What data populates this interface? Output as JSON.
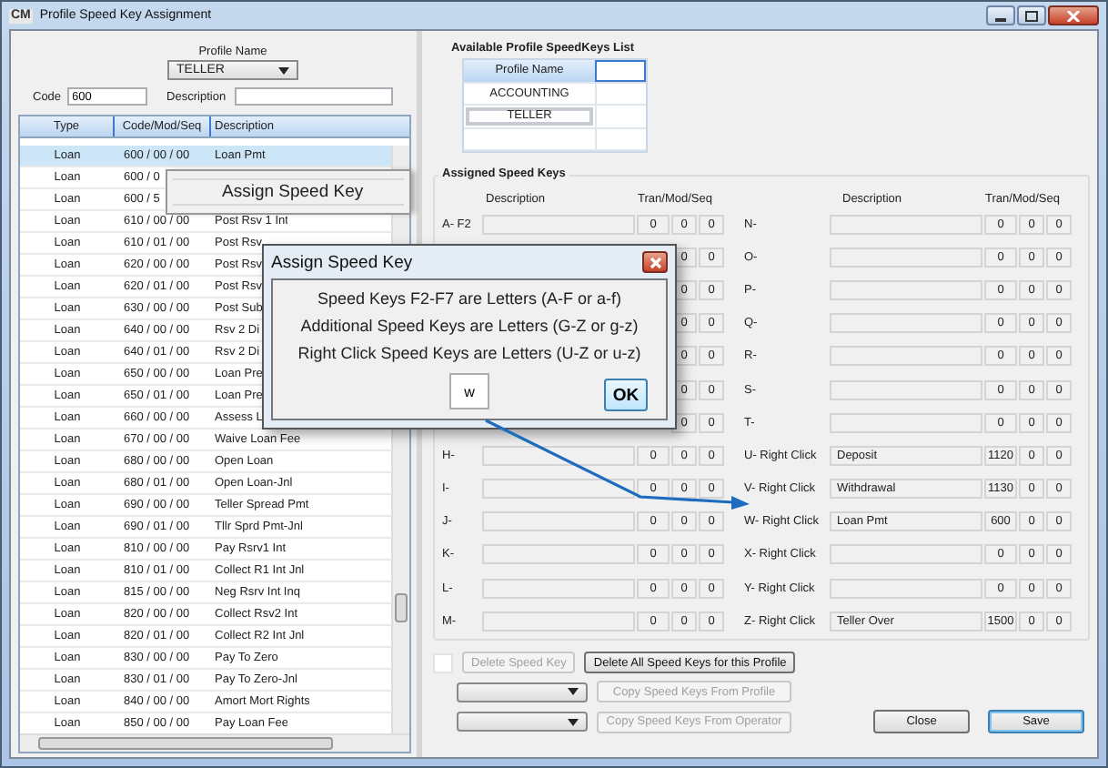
{
  "window": {
    "title": "Profile Speed Key Assignment",
    "logo": "CM"
  },
  "profile": {
    "label": "Profile Name",
    "value": "TELLER"
  },
  "filters": {
    "code_label": "Code",
    "code_value": "600",
    "description_label": "Description"
  },
  "codes_table": {
    "columns": [
      "Type",
      "Code/Mod/Seq",
      "Description"
    ],
    "rows": [
      {
        "type": "Loan",
        "code": "600 / 00 / 00",
        "description": "Loan Pmt",
        "selected": true
      },
      {
        "type": "Loan",
        "code": "600 / 0",
        "selected": false
      },
      {
        "type": "Loan",
        "code": "600 / 5",
        "selected": false
      },
      {
        "type": "Loan",
        "code": "610 / 00 / 00",
        "description": "Post Rsv 1 Int",
        "selected": false
      },
      {
        "type": "Loan",
        "code": "610 / 01 / 00",
        "description": "Post Rsv",
        "selected": false
      },
      {
        "type": "Loan",
        "code": "620 / 00 / 00",
        "description": "Post Rsv",
        "selected": false
      },
      {
        "type": "Loan",
        "code": "620 / 01 / 00",
        "description": "Post Rsv",
        "selected": false
      },
      {
        "type": "Loan",
        "code": "630 / 00 / 00",
        "description": "Post Sub",
        "selected": false
      },
      {
        "type": "Loan",
        "code": "640 / 00 / 00",
        "description": "Rsv 2 Di",
        "selected": false
      },
      {
        "type": "Loan",
        "code": "640 / 01 / 00",
        "description": "Rsv 2 Di",
        "selected": false
      },
      {
        "type": "Loan",
        "code": "650 / 00 / 00",
        "description": "Loan Pre",
        "selected": false
      },
      {
        "type": "Loan",
        "code": "650 / 01 / 00",
        "description": "Loan Pre",
        "selected": false
      },
      {
        "type": "Loan",
        "code": "660 / 00 / 00",
        "description": "Assess L",
        "selected": false
      },
      {
        "type": "Loan",
        "code": "670 / 00 / 00",
        "description": "Waive Loan Fee",
        "selected": false
      },
      {
        "type": "Loan",
        "code": "680 / 00 / 00",
        "description": "Open Loan",
        "selected": false
      },
      {
        "type": "Loan",
        "code": "680 / 01 / 00",
        "description": "Open Loan-Jnl",
        "selected": false
      },
      {
        "type": "Loan",
        "code": "690 / 00 / 00",
        "description": "Teller Spread Pmt",
        "selected": false
      },
      {
        "type": "Loan",
        "code": "690 / 01 / 00",
        "description": "Tllr Sprd Pmt-Jnl",
        "selected": false
      },
      {
        "type": "Loan",
        "code": "810 / 00 / 00",
        "description": "Pay Rsrv1 Int",
        "selected": false
      },
      {
        "type": "Loan",
        "code": "810 / 01 / 00",
        "description": "Collect R1 Int Jnl",
        "selected": false
      },
      {
        "type": "Loan",
        "code": "815 / 00 / 00",
        "description": "Neg Rsrv Int Inq",
        "selected": false
      },
      {
        "type": "Loan",
        "code": "820 / 00 / 00",
        "description": "Collect Rsv2 Int",
        "selected": false
      },
      {
        "type": "Loan",
        "code": "820 / 01 / 00",
        "description": "Collect R2 Int Jnl",
        "selected": false
      },
      {
        "type": "Loan",
        "code": "830 / 00 / 00",
        "description": "Pay To Zero",
        "selected": false
      },
      {
        "type": "Loan",
        "code": "830 / 01 / 00",
        "description": "Pay To Zero-Jnl",
        "selected": false
      },
      {
        "type": "Loan",
        "code": "840 / 00 / 00",
        "description": "Amort Mort Rights",
        "selected": false
      },
      {
        "type": "Loan",
        "code": "850 / 00 / 00",
        "description": "Pay Loan Fee",
        "selected": false
      }
    ]
  },
  "available_profiles": {
    "title": "Available Profile SpeedKeys List",
    "column": "Profile Name",
    "rows": [
      {
        "name": "ACCOUNTING",
        "selected": false
      },
      {
        "name": "TELLER",
        "selected": true
      }
    ]
  },
  "assigned": {
    "title": "Assigned Speed Keys",
    "left_headers": {
      "description": "Description",
      "code": "Tran/Mod/Seq"
    },
    "right_headers": {
      "description": "Description",
      "code": "Tran/Mod/Seq"
    },
    "left_keys": [
      {
        "label": "A- F2",
        "tran": "0",
        "mod": "0",
        "seq": "0"
      },
      {
        "mod": "0",
        "seq": "0"
      },
      {
        "mod": "0",
        "seq": "0"
      },
      {
        "mod": "0",
        "seq": "0"
      },
      {
        "mod": "0",
        "seq": "0"
      },
      {
        "mod": "0",
        "seq": "0"
      },
      {
        "mod": "0",
        "seq": "0"
      },
      {
        "label": "H-",
        "tran": "0",
        "mod": "0",
        "seq": "0"
      },
      {
        "label": "I-",
        "tran": "0",
        "mod": "0",
        "seq": "0"
      },
      {
        "label": "J-",
        "tran": "0",
        "mod": "0",
        "seq": "0"
      },
      {
        "label": "K-",
        "tran": "0",
        "mod": "0",
        "seq": "0"
      },
      {
        "label": "L-",
        "tran": "0",
        "mod": "0",
        "seq": "0"
      },
      {
        "label": "M-",
        "tran": "0",
        "mod": "0",
        "seq": "0"
      }
    ],
    "right_keys": [
      {
        "label": "N-",
        "tran": "0",
        "mod": "0",
        "seq": "0"
      },
      {
        "label": "O-",
        "tran": "0",
        "mod": "0",
        "seq": "0"
      },
      {
        "label": "P-",
        "tran": "0",
        "mod": "0",
        "seq": "0"
      },
      {
        "label": "Q-",
        "tran": "0",
        "mod": "0",
        "seq": "0"
      },
      {
        "label": "R-",
        "tran": "0",
        "mod": "0",
        "seq": "0"
      },
      {
        "label": "S-",
        "tran": "0",
        "mod": "0",
        "seq": "0"
      },
      {
        "label": "T-",
        "tran": "0",
        "mod": "0",
        "seq": "0"
      },
      {
        "label": "U- Right Click",
        "description": "Deposit",
        "tran": "1120",
        "mod": "0",
        "seq": "0"
      },
      {
        "label": "V- Right Click",
        "description": "Withdrawal",
        "tran": "1130",
        "mod": "0",
        "seq": "0"
      },
      {
        "label": "W- Right Click",
        "description": "Loan Pmt",
        "tran": "600",
        "mod": "0",
        "seq": "0"
      },
      {
        "label": "X- Right Click",
        "tran": "0",
        "mod": "0",
        "seq": "0"
      },
      {
        "label": "Y- Right Click",
        "tran": "0",
        "mod": "0",
        "seq": "0"
      },
      {
        "label": "Z- Right Click",
        "description": "Teller Over",
        "tran": "1500",
        "mod": "0",
        "seq": "0"
      }
    ]
  },
  "actions": {
    "checkbox": {
      "checked": false
    },
    "delete_key": {
      "label": "Delete Speed Key",
      "disabled": true
    },
    "delete_all": {
      "label": "Delete All Speed Keys for this Profile",
      "disabled": false
    },
    "copy_profile": {
      "label": "Copy Speed Keys From Profile",
      "disabled": true
    },
    "copy_operator": {
      "label": "Copy Speed Keys From Operator",
      "disabled": true
    },
    "close": {
      "label": "Close",
      "disabled": false
    },
    "save": {
      "label": "Save",
      "disabled": false
    }
  },
  "context_menu": {
    "items": [
      "Assign Speed Key"
    ]
  },
  "dialog": {
    "title": "Assign Speed Key",
    "lines": [
      "Speed Keys F2-F7 are Letters (A-F or a-f)",
      "Additional Speed Keys are Letters (G-Z or g-z)",
      "Right Click Speed Keys are Letters (U-Z or u-z)"
    ],
    "value": "w",
    "ok": "OK"
  }
}
